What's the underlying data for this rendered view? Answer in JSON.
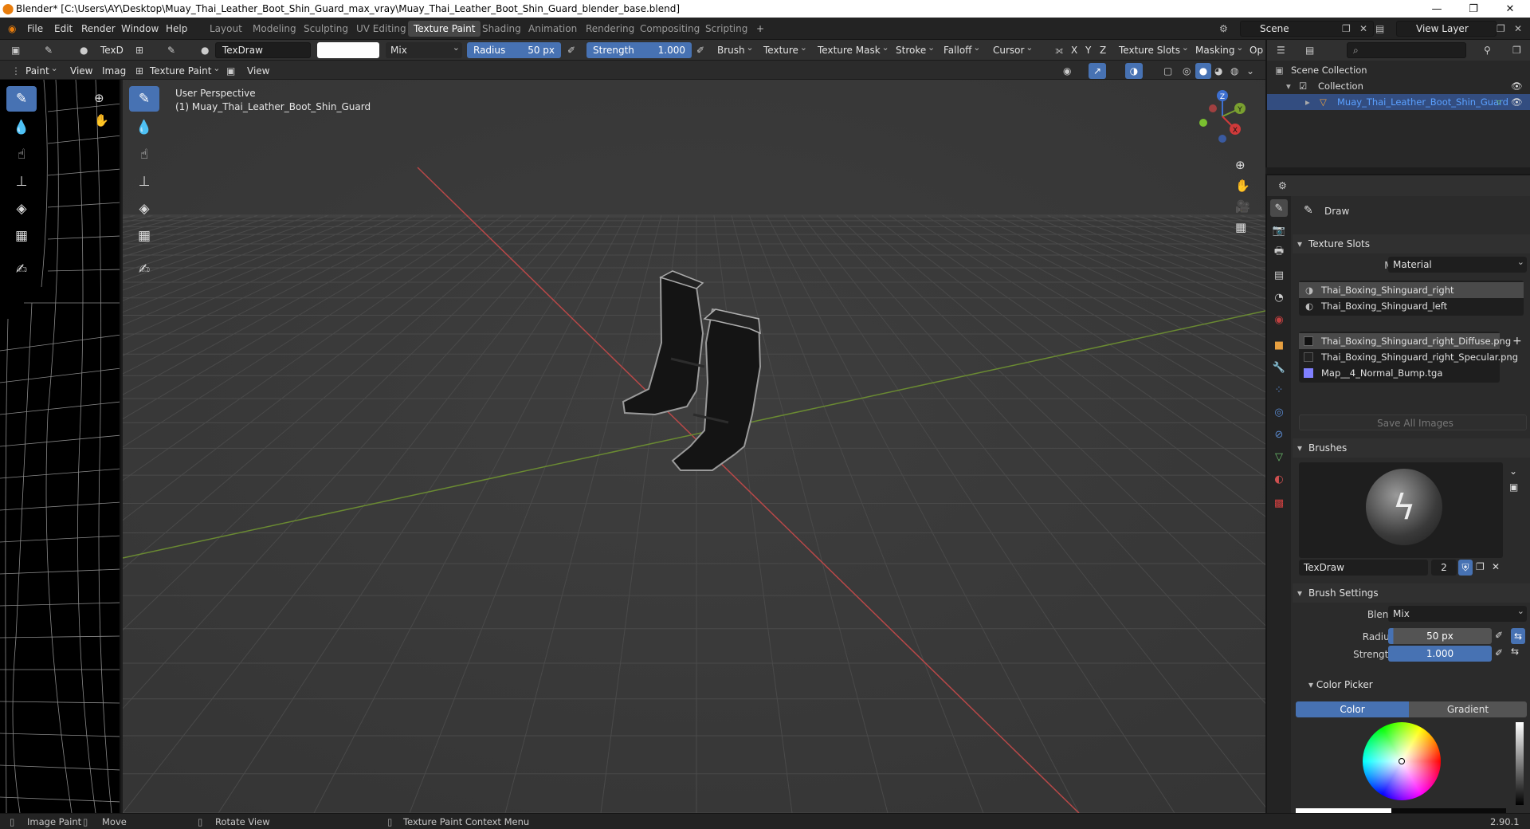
{
  "titlebar": {
    "title": "Blender* [C:\\Users\\AY\\Desktop\\Muay_Thai_Leather_Boot_Shin_Guard_max_vray\\Muay_Thai_Leather_Boot_Shin_Guard_blender_base.blend]",
    "min": "—",
    "max": "❐",
    "close": "✕"
  },
  "menu": [
    "File",
    "Edit",
    "Render",
    "Window",
    "Help"
  ],
  "workspaces": [
    "Layout",
    "Modeling",
    "Sculpting",
    "UV Editing",
    "Texture Paint",
    "Shading",
    "Animation",
    "Rendering",
    "Compositing",
    "Scripting"
  ],
  "workspace_add": "+",
  "scene": {
    "value": "Scene"
  },
  "view_layer": {
    "value": "View Layer"
  },
  "toolheader": {
    "brush_short": "TexD",
    "brush_name": "TexDraw",
    "blend": "Mix",
    "radius_label": "Radius",
    "radius_value": "50 px",
    "strength_label": "Strength",
    "strength_value": "1.000",
    "menus": [
      "Brush",
      "Texture",
      "Texture Mask",
      "Stroke",
      "Falloff",
      "Cursor"
    ],
    "axes": [
      "X",
      "Y",
      "Z"
    ],
    "right_menus": [
      "Texture Slots",
      "Masking",
      "Op"
    ]
  },
  "subheader": {
    "left_mode": "Paint",
    "left_view": "View",
    "left_image": "Imag",
    "mode": "Texture Paint",
    "view": "View"
  },
  "viewport": {
    "perspective": "User Perspective",
    "object": "(1) Muay_Thai_Leather_Boot_Shin_Guard",
    "gizmo": {
      "z": "Z",
      "y": "Y",
      "x": "X"
    }
  },
  "outliner": {
    "scene_collection": "Scene Collection",
    "collection": "Collection",
    "object": "Muay_Thai_Leather_Boot_Shin_Guard"
  },
  "properties": {
    "tool_name": "Draw",
    "texture_slots": {
      "title": "Texture Slots",
      "mode_label": "Mode",
      "mode_value": "Material",
      "materials": [
        "Thai_Boxing_Shinguard_right",
        "Thai_Boxing_Shinguard_left"
      ],
      "images": [
        "Thai_Boxing_Shinguard_right_Diffuse.png",
        "Thai_Boxing_Shinguard_right_Specular.png",
        "Map__4_Normal_Bump.tga"
      ],
      "save_all": "Save All Images"
    },
    "brushes": {
      "title": "Brushes",
      "name": "TexDraw",
      "users": "2"
    },
    "brush_settings": {
      "title": "Brush Settings",
      "blend_label": "Blend",
      "blend_value": "Mix",
      "radius_label": "Radius",
      "radius_value": "50 px",
      "strength_label": "Strength",
      "strength_value": "1.000"
    },
    "color_picker": {
      "title": "Color Picker",
      "tab_color": "Color",
      "tab_gradient": "Gradient"
    }
  },
  "statusbar": {
    "left1": "Image Paint",
    "left2": "Move",
    "middle": "Rotate View",
    "right": "Texture Paint Context Menu",
    "version": "2.90.1"
  },
  "colors": {
    "accent": "#4772b3",
    "red_axis": "#c94a4a",
    "green_axis": "#7a9a3a",
    "selected_text": "#5aa0ff"
  }
}
